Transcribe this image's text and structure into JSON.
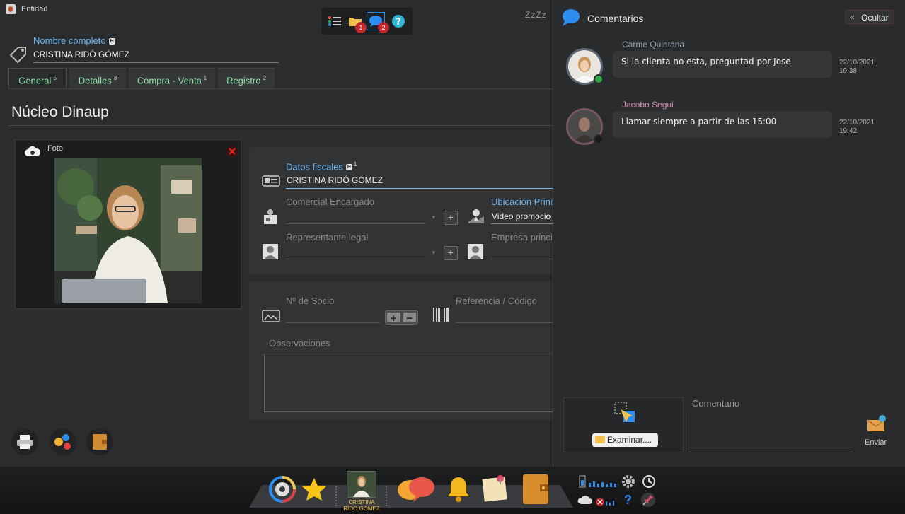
{
  "window": {
    "title": "Entidad"
  },
  "toolbar": {
    "list_icon": "list-icon",
    "folder_badge": "1",
    "comments_badge": "2",
    "help_icon": "help-icon",
    "sleep_text": "ZzZz"
  },
  "entity": {
    "name_label": "Nombre completo",
    "name_value": "CRISTINA RIDÓ GÓMEZ"
  },
  "tabs": [
    {
      "label": "General",
      "count": "5",
      "active": true
    },
    {
      "label": "Detalles",
      "count": "3",
      "active": false
    },
    {
      "label": "Compra - Venta",
      "count": "1",
      "active": false
    },
    {
      "label": "Registro",
      "count": "2",
      "active": false
    }
  ],
  "section_title": "Núcleo Dinaup",
  "photo": {
    "label": "Foto"
  },
  "fiscal": {
    "label": "Datos fiscales",
    "count": "1",
    "value": "CRISTINA RIDÓ GÓMEZ",
    "comercial_label": "Comercial Encargado",
    "comercial_value": "",
    "ubicacion_label": "Ubicación Princ",
    "ubicacion_value": "Video promocio",
    "representante_label": "Representante legal",
    "representante_value": "",
    "empresa_label": "Empresa princip",
    "empresa_value": ""
  },
  "socio": {
    "socio_label": "Nº de Socio",
    "socio_value": "",
    "referencia_label": "Referencia / Código",
    "referencia_value": "",
    "observaciones_label": "Observaciones"
  },
  "comments_panel": {
    "title": "Comentarios",
    "hide_label": "Ocultar",
    "comments": [
      {
        "author": "Carme Quintana",
        "author_color": "#9fa8b8",
        "text": "Si la clienta no esta, preguntad por Jose",
        "date": "22/10/2021",
        "time": "19:38",
        "status": "online"
      },
      {
        "author": "Jacobo Segui",
        "author_color": "#d98ab8",
        "text": "Llamar siempre a partir de las 15:00",
        "date": "22/10/2021",
        "time": "19:42",
        "status": "offline"
      }
    ],
    "browse_label": "Examinar....",
    "comment_label": "Comentario",
    "comment_value": "",
    "send_label": "Enviar"
  },
  "dock": {
    "entity_label": "CRISTINA RIDÓ GÓMEZ"
  }
}
